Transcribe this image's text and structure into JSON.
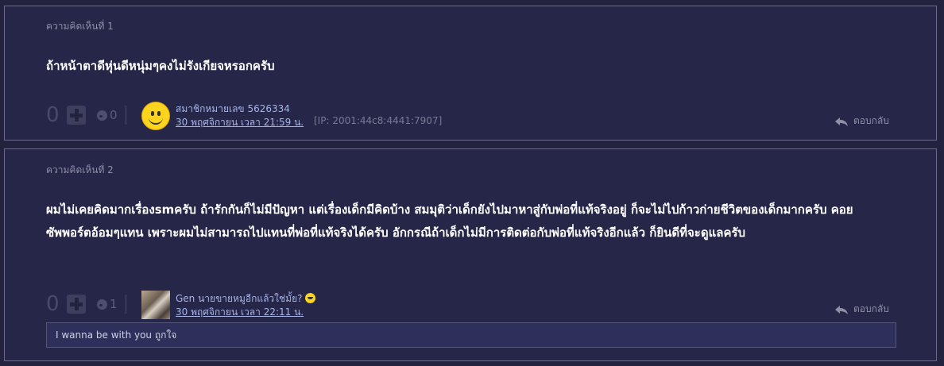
{
  "comments": [
    {
      "label": "ความคิดเห็นที่ 1",
      "body": "ถ้าหน้าตาดีหุ่นดีหนุ่มๆคงไม่รังเกียจหรอกครับ",
      "vote_count": "0",
      "emo_count": "0",
      "user_name": "สมาชิกหมายเลข 5626334",
      "post_time": "30 พฤศจิกายน เวลา 21:59 น.",
      "ip": "[IP: 2001:44c8:4441:7907]",
      "reply_label": "ตอบกลับ",
      "avatar_icon": "smiley-avatar-icon"
    },
    {
      "label": "ความคิดเห็นที่ 2",
      "body": "ผมไม่เคยคิดมากเรื่องsmครับ ถ้ารักกันก็ไม่มีปัญหา แต่เรื่องเด็กมีคิดบ้าง สมมุติว่าเด็กยังไปมาหาสู่กับพ่อที่แท้จริงอยู่ ก็จะไม่ไปก้าวก่ายชีวิตของเด็กมากครับ คอยซัพพอร์ตอ้อมๆแทน เพราะผมไม่สามารถไปแทนที่พ่อที่แท้จริงได้ครับ อักกรณีถ้าเด็กไม่มีการติดต่อกับพ่อที่แท้จริงอีกแล้ว ก็ยินดีที่จะดูแลครับ",
      "vote_count": "0",
      "emo_count": "1",
      "user_name": "Gen นายขายหมูอีกแล้วใช่มั้ย?",
      "post_time": "30 พฤศจิกายน เวลา 22:11 น.",
      "reply_label": "ตอบกลับ",
      "reply_input_value": "I wanna be with you ถูกใจ",
      "avatar_icon": "photo-avatar-icon",
      "badge_icon": "laughing-emoji-icon"
    }
  ],
  "colors": {
    "page_bg": "#23233f",
    "panel_bg": "#262648",
    "panel_border": "#6a6a8a",
    "link": "#a8b4e8",
    "muted": "#8f8fa8"
  }
}
